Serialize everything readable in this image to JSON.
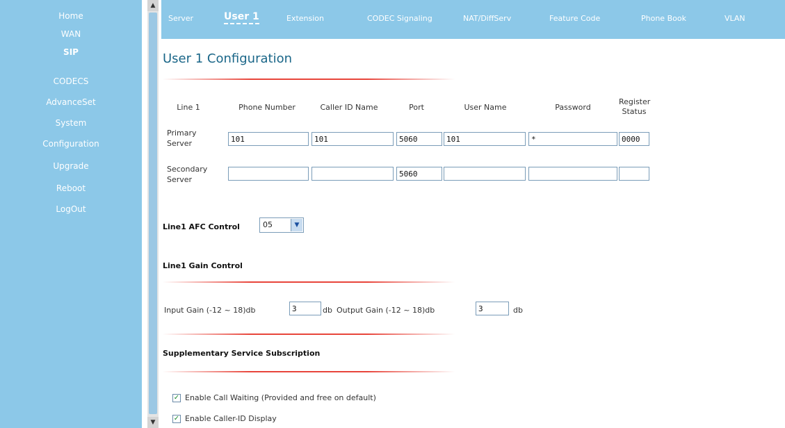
{
  "sidebar": {
    "items": [
      {
        "label": "Home"
      },
      {
        "label": "WAN"
      },
      {
        "label": "SIP"
      },
      {
        "label": "CODECS"
      },
      {
        "label": "AdvanceSet"
      },
      {
        "label": "System"
      },
      {
        "label": "Configuration"
      },
      {
        "label": "Upgrade"
      },
      {
        "label": "Reboot"
      },
      {
        "label": "LogOut"
      }
    ],
    "active": "SIP"
  },
  "tabs": [
    {
      "label": "Server"
    },
    {
      "label": "User 1"
    },
    {
      "label": "Extension"
    },
    {
      "label": "CODEC Signaling"
    },
    {
      "label": "NAT/DiffServ"
    },
    {
      "label": "Feature Code"
    },
    {
      "label": "Phone Book"
    },
    {
      "label": "VLAN"
    }
  ],
  "page": {
    "title": "User 1 Configuration"
  },
  "table": {
    "headers": [
      "Line 1",
      "Phone Number",
      "Caller ID Name",
      "Port",
      "User Name",
      "Password",
      "Register Status"
    ],
    "rows": [
      {
        "label_line1": "Primary",
        "label_line2": "Server",
        "phone": "101",
        "caller_id": "101",
        "port": "5060",
        "user": "101",
        "password": "*",
        "status": "0000"
      },
      {
        "label_line1": "Secondary",
        "label_line2": "Server",
        "phone": "",
        "caller_id": "",
        "port": "5060",
        "user": "",
        "password": "",
        "status": ""
      }
    ]
  },
  "afc": {
    "label": "Line1 AFC Control",
    "value": "05"
  },
  "gain": {
    "section_label": "Line1 Gain Control",
    "input_label": "Input Gain (-12 ~ 18)db",
    "input_value": "3",
    "db_label_1": "db",
    "output_label": "Output Gain (-12 ~ 18)db",
    "output_value": "3",
    "db_label_2": "db"
  },
  "supplementary": {
    "section_label": "Supplementary Service Subscription",
    "options": [
      {
        "label": "Enable Call Waiting (Provided and free on default)",
        "checked": true
      },
      {
        "label": "Enable Caller-ID Display",
        "checked": true
      }
    ]
  },
  "colors": {
    "nav_bg": "#8cc8e8",
    "title_color": "#1a6688",
    "rule_red": "#e8443a"
  }
}
